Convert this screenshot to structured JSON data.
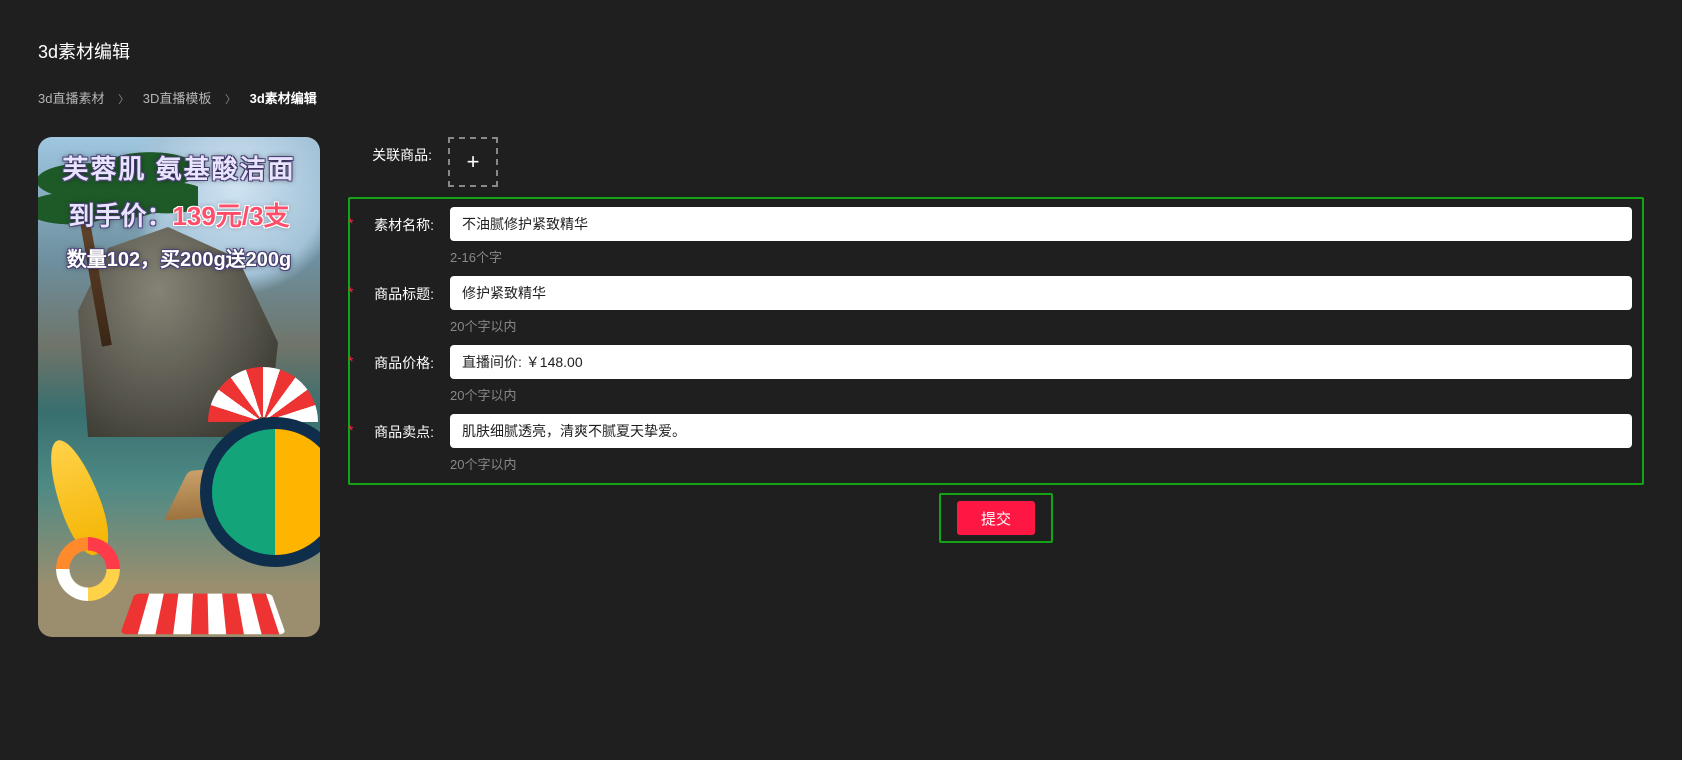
{
  "page": {
    "title": "3d素材编辑"
  },
  "breadcrumb": {
    "items": [
      "3d直播素材",
      "3D直播模板",
      "3d素材编辑"
    ]
  },
  "preview": {
    "line1": "芙蓉肌 氨基酸洁面",
    "line2_prefix": "到手价：",
    "line2_price": "139元/3支",
    "line3": "数量102，买200g送200g"
  },
  "form": {
    "related_product": {
      "label": "关联商品:"
    },
    "name": {
      "label": "素材名称:",
      "value": "不油腻修护紧致精华",
      "hint": "2-16个字"
    },
    "title": {
      "label": "商品标题:",
      "value": "修护紧致精华",
      "hint": "20个字以内"
    },
    "price": {
      "label": "商品价格:",
      "value": "直播间价: ￥148.00",
      "hint": "20个字以内"
    },
    "usp": {
      "label": "商品卖点:",
      "value": "肌肤细腻透亮，清爽不腻夏天挚爱。",
      "hint": "20个字以内"
    },
    "submit": "提交"
  }
}
